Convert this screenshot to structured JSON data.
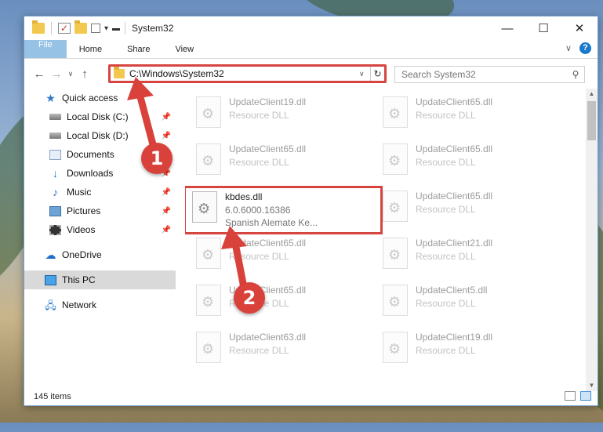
{
  "window": {
    "title": "System32"
  },
  "ribbon": {
    "tabs": [
      "File",
      "Home",
      "Share",
      "View"
    ]
  },
  "address": {
    "path": "C:\\Windows\\System32"
  },
  "search": {
    "placeholder": "Search System32"
  },
  "sidebar": {
    "items": [
      {
        "label": "Quick access",
        "icon": "star-icon"
      },
      {
        "label": "Local Disk (C:)",
        "icon": "drive-icon",
        "pinned": true
      },
      {
        "label": "Local Disk (D:)",
        "icon": "drive-icon",
        "pinned": true
      },
      {
        "label": "Documents",
        "icon": "documents-icon",
        "pinned": true
      },
      {
        "label": "Downloads",
        "icon": "download-icon",
        "pinned": true
      },
      {
        "label": "Music",
        "icon": "music-icon",
        "pinned": true
      },
      {
        "label": "Pictures",
        "icon": "pictures-icon",
        "pinned": true
      },
      {
        "label": "Videos",
        "icon": "videos-icon",
        "pinned": true
      },
      {
        "label": "OneDrive",
        "icon": "cloud-icon"
      },
      {
        "label": "This PC",
        "icon": "computer-icon",
        "selected": true
      },
      {
        "label": "Network",
        "icon": "network-icon"
      }
    ]
  },
  "files": [
    {
      "name": "UpdateClient19.dll",
      "sub1": "Resource DLL",
      "sub2": ""
    },
    {
      "name": "UpdateClient65.dll",
      "sub1": "Resource DLL",
      "sub2": ""
    },
    {
      "name": "UpdateClient65.dll",
      "sub1": "Resource DLL",
      "sub2": ""
    },
    {
      "name": "UpdateClient65.dll",
      "sub1": "Resource DLL",
      "sub2": ""
    },
    {
      "name": "kbdes.dll",
      "sub1": "6.0.6000.16386",
      "sub2": "Spanish Alemate Ke...",
      "highlighted": true
    },
    {
      "name": "UpdateClient65.dll",
      "sub1": "Resource DLL",
      "sub2": ""
    },
    {
      "name": "UpdateClient65.dll",
      "sub1": "Resource DLL",
      "sub2": ""
    },
    {
      "name": "UpdateClient21.dll",
      "sub1": "Resource DLL",
      "sub2": ""
    },
    {
      "name": "UpdateClient65.dll",
      "sub1": "Resource DLL",
      "sub2": ""
    },
    {
      "name": "UpdateClient5.dll",
      "sub1": "Resource DLL",
      "sub2": ""
    },
    {
      "name": "UpdateClient63.dll",
      "sub1": "Resource DLL",
      "sub2": ""
    },
    {
      "name": "UpdateClient19.dll",
      "sub1": "Resource DLL",
      "sub2": ""
    }
  ],
  "status": {
    "item_count": "145 items"
  },
  "callouts": {
    "one": "1",
    "two": "2"
  },
  "colors": {
    "accent": "#1979ca",
    "highlight": "#d64540"
  }
}
